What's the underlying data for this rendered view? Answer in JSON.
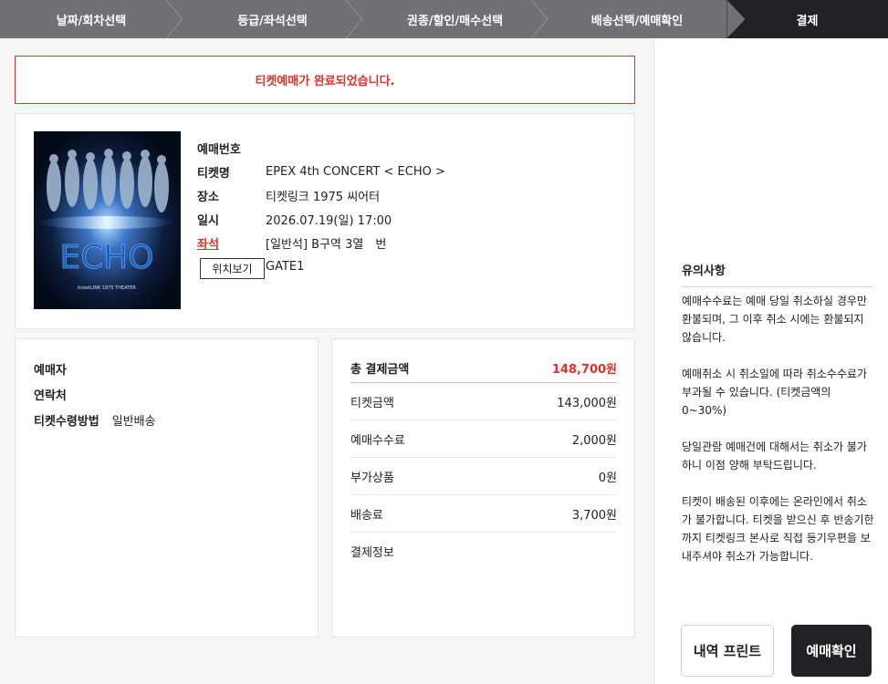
{
  "steps": [
    {
      "label": "날짜/회차선택"
    },
    {
      "label": "등급/좌석선택"
    },
    {
      "label": "권종/할인/매수선택"
    },
    {
      "label": "배송선택/예매확인"
    },
    {
      "label": "결제"
    }
  ],
  "notice": "티켓예매가 완료되었습니다.",
  "poster": {
    "title_text": "ECHO",
    "caption": "ticketLINK 1975 THEATER"
  },
  "booking": {
    "reservation_no_label": "예매번호",
    "reservation_no_value": "",
    "ticket_name_label": "티켓명",
    "ticket_name_value": "EPEX 4th CONCERT < ECHO >",
    "venue_label": "장소",
    "venue_value": "티켓링크 1975 씨어터",
    "datetime_label": "일시",
    "datetime_value": "2026.07.19(일) 17:00",
    "seat_label": "좌석",
    "seat_value": "[일반석] B구역 3열　번",
    "gate_value": "GATE1",
    "location_tooltip": "위치보기"
  },
  "buyer": {
    "booker_label": "예매자",
    "contact_label": "연락처",
    "delivery_label": "티켓수령방법",
    "delivery_value": "일반배송"
  },
  "payment": {
    "total_label": "총 결제금액",
    "total_value": "148,700원",
    "rows": [
      {
        "label": "티켓금액",
        "value": "143,000원"
      },
      {
        "label": "예매수수료",
        "value": "2,000원"
      },
      {
        "label": "부가상품",
        "value": "0원"
      },
      {
        "label": "배송료",
        "value": "3,700원"
      },
      {
        "label": "결제정보",
        "value": ""
      }
    ]
  },
  "sidebar": {
    "notes_title": "유의사항",
    "notes": [
      "예매수수료는 예매 당일 취소하실 경우만 환불되며, 그 이후 취소 시에는 환불되지 않습니다.",
      "예매취소 시 취소일에 따라 취소수수료가 부과될 수 있습니다. (티켓금액의 0~30%)",
      "당일관람 예매건에 대해서는 취소가 불가하니 이점 양해 부탁드립니다.",
      "티켓이 배송된 이후에는 온라인에서 취소가 불가합니다. 티켓을 받으신 후 반송기한까지 티켓링크 본사로 직접 등기우편을 보내주셔야 취소가 가능합니다."
    ],
    "print_label": "내역 프린트",
    "confirm_label": "예매확인"
  },
  "colors": {
    "accent": "#e0302a",
    "dark": "#222226",
    "stepper": "#6f7175"
  }
}
